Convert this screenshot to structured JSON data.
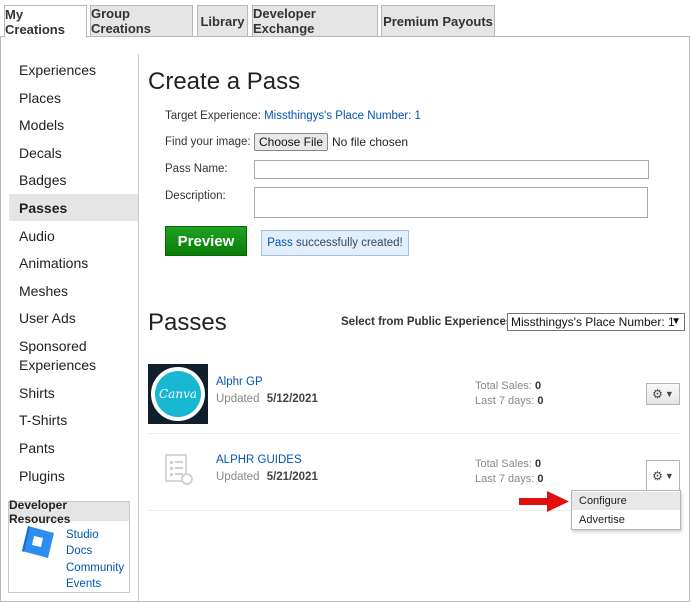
{
  "tabs": [
    {
      "label": "My Creations"
    },
    {
      "label": "Group Creations"
    },
    {
      "label": "Library"
    },
    {
      "label": "Developer Exchange"
    },
    {
      "label": "Premium Payouts"
    }
  ],
  "sidebar": {
    "items": [
      {
        "label": "Experiences"
      },
      {
        "label": "Places"
      },
      {
        "label": "Models"
      },
      {
        "label": "Decals"
      },
      {
        "label": "Badges"
      },
      {
        "label": "Passes"
      },
      {
        "label": "Audio"
      },
      {
        "label": "Animations"
      },
      {
        "label": "Meshes"
      },
      {
        "label": "User Ads"
      },
      {
        "label": "Sponsored Experiences"
      },
      {
        "label": "Shirts"
      },
      {
        "label": "T-Shirts"
      },
      {
        "label": "Pants"
      },
      {
        "label": "Plugins"
      }
    ],
    "selected": "Passes"
  },
  "developer_resources": {
    "title": "Developer Resources",
    "links": [
      "Studio",
      "Docs",
      "Community",
      "Events"
    ]
  },
  "create_pass": {
    "title": "Create a Pass",
    "target_label": "Target Experience:",
    "target_value": "Missthingys's Place Number: 1",
    "image_label": "Find your image:",
    "choose_file": "Choose File",
    "no_file": "No file chosen",
    "name_label": "Pass Name:",
    "name_value": "",
    "desc_label": "Description:",
    "desc_value": "",
    "preview": "Preview",
    "success_prefix": "Pass",
    "success_rest": " successfully created!"
  },
  "passes": {
    "title": "Passes",
    "select_label": "Select from Public Experiences:",
    "select_value": "Missthingys's Place Number: 1",
    "items": [
      {
        "name": "Alphr GP",
        "updated_label": "Updated",
        "updated": "5/12/2021",
        "sales_label": "Total Sales:",
        "sales": "0",
        "last7_label": "Last 7 days:",
        "last7": "0",
        "thumb_text": "Canva"
      },
      {
        "name": "ALPHR GUIDES",
        "updated_label": "Updated",
        "updated": "5/21/2021",
        "sales_label": "Total Sales:",
        "sales": "0",
        "last7_label": "Last 7 days:",
        "last7": "0"
      }
    ],
    "menu": [
      "Configure",
      "Advertise"
    ]
  },
  "icons": {
    "gear": "gear-icon",
    "chevron": "chevron-down-icon",
    "arrow": "red-arrow-annotation"
  },
  "colors": {
    "link": "#0055b3",
    "preview_button": "#0a7d0a",
    "success_bg": "#e2eefa",
    "annotation_arrow": "#e01010"
  }
}
